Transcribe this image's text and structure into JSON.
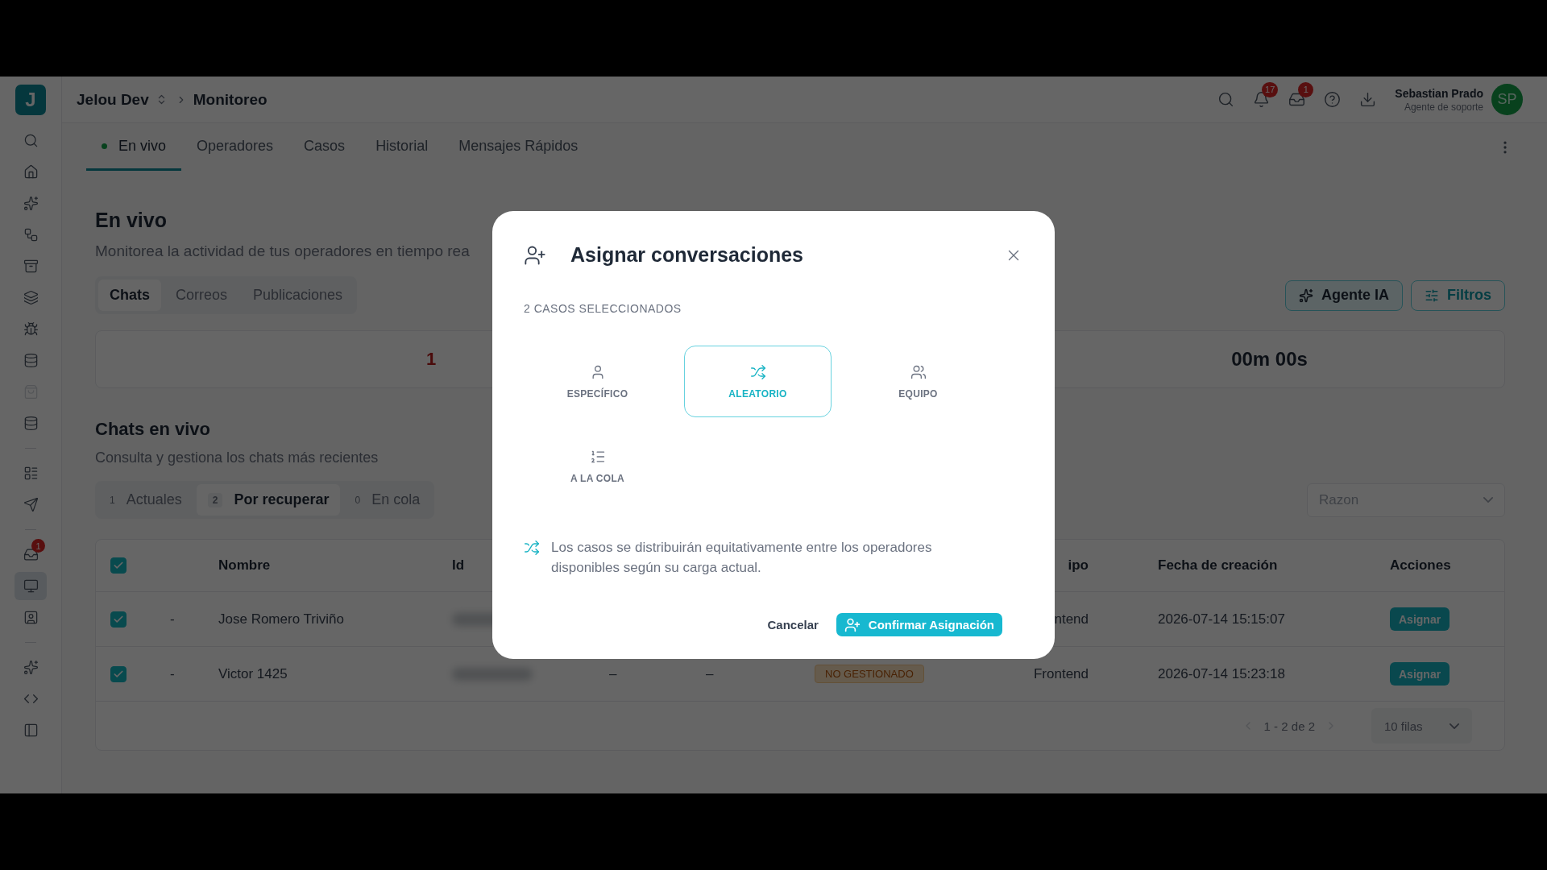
{
  "header": {
    "workspace": "Jelou Dev",
    "page": "Monitoreo",
    "notifications": "17",
    "inbox_count": "1",
    "user_name": "Sebastian Prado",
    "user_role": "Agente de soporte",
    "avatar": "SP"
  },
  "sidebar": {
    "logo": "J",
    "items": [
      {
        "kind": "search",
        "selected": false,
        "disabled": false
      },
      {
        "kind": "home",
        "selected": false,
        "disabled": false
      },
      {
        "kind": "sparkles",
        "selected": false,
        "disabled": false
      },
      {
        "kind": "workflow",
        "selected": false,
        "disabled": false
      },
      {
        "kind": "archive",
        "selected": false,
        "disabled": false
      },
      {
        "kind": "layers",
        "selected": false,
        "disabled": false
      },
      {
        "kind": "bug",
        "selected": false,
        "disabled": false
      },
      {
        "kind": "database",
        "selected": false,
        "disabled": false
      },
      {
        "kind": "bag",
        "selected": false,
        "disabled": true
      },
      {
        "kind": "database",
        "selected": false,
        "disabled": false
      },
      {
        "kind": "divider"
      },
      {
        "kind": "layout",
        "selected": false,
        "disabled": false
      },
      {
        "kind": "send",
        "selected": false,
        "disabled": false
      },
      {
        "kind": "divider"
      },
      {
        "kind": "inbox",
        "selected": false,
        "disabled": false,
        "badge": "1"
      },
      {
        "kind": "monitor",
        "selected": true,
        "disabled": false
      },
      {
        "kind": "contact",
        "selected": false,
        "disabled": false
      },
      {
        "kind": "divider"
      },
      {
        "kind": "sparkles",
        "selected": false,
        "disabled": false
      },
      {
        "kind": "partial",
        "selected": false,
        "disabled": false
      },
      {
        "kind": "panel",
        "selected": false,
        "disabled": false
      }
    ]
  },
  "tabs": [
    {
      "label": "En vivo",
      "selected": true,
      "live": true
    },
    {
      "label": "Operadores",
      "selected": false,
      "live": false
    },
    {
      "label": "Casos",
      "selected": false,
      "live": false
    },
    {
      "label": "Historial",
      "selected": false,
      "live": false
    },
    {
      "label": "Mensajes Rápidos",
      "selected": false,
      "live": false
    }
  ],
  "page": {
    "title": "En vivo",
    "subtitle": "Monitorea la actividad de tus operadores en tiempo rea"
  },
  "channel_tabs": [
    {
      "label": "Chats",
      "selected": true
    },
    {
      "label": "Correos",
      "selected": false
    },
    {
      "label": "Publicaciones",
      "selected": false
    }
  ],
  "actions": [
    {
      "kind": "ai",
      "label": "Agente IA"
    },
    {
      "kind": "filter",
      "label": "Filtros"
    }
  ],
  "stats": [
    {
      "value": "1",
      "kind": "alert"
    },
    {
      "value": "00m 00s",
      "kind": "normal"
    }
  ],
  "chats": {
    "title": "Chats en vivo",
    "subtitle": "Consulta y gestiona los chats más recientes",
    "filters": [
      {
        "count": "1",
        "label": "Actuales",
        "selected": false
      },
      {
        "count": "2",
        "label": "Por recuperar",
        "selected": true
      },
      {
        "count": "0",
        "label": "En cola",
        "selected": false
      }
    ],
    "reason_select": {
      "placeholder": "Razon"
    }
  },
  "table": {
    "select_all_checked": true,
    "columns": [
      {
        "kind": "name",
        "label": "Nombre"
      },
      {
        "kind": "id",
        "label": "Id"
      },
      {
        "kind": "team",
        "label": "ipo"
      },
      {
        "kind": "created",
        "label": "Fecha de creación"
      },
      {
        "kind": "actions",
        "label": "Acciones"
      }
    ],
    "rows": [
      {
        "checked": true,
        "dash": "-",
        "name": "Jose Romero Triviño",
        "team": "ntend",
        "created": "2026-07-14 15:15:07",
        "action": "Asignar"
      },
      {
        "checked": true,
        "dash": "-",
        "name": "Victor 1425",
        "col_5": "–",
        "col_6": "–",
        "status": "NO GESTIONADO",
        "team": "Frontend",
        "created": "2026-07-14 15:23:18",
        "action": "Asignar"
      }
    ],
    "pagination": "1 - 2 de 2",
    "page_size": "10 filas"
  },
  "modal": {
    "title": "Asignar conversaciones",
    "count": "2 CASOS SELECCIONADOS",
    "options": [
      {
        "kind": "user",
        "label": "ESPECÍFICO",
        "selected": false
      },
      {
        "kind": "shuffle",
        "label": "ALEATORIO",
        "selected": true
      },
      {
        "kind": "users",
        "label": "EQUIPO",
        "selected": false
      },
      {
        "kind": "queue",
        "label": "A LA COLA",
        "selected": false
      }
    ],
    "info": {
      "kind": "shuffle",
      "text": "Los casos se distribuirán equitativamente entre los operadores disponibles según su carga actual."
    },
    "cancel": "Cancelar",
    "confirm": "Confirmar Asignación"
  }
}
